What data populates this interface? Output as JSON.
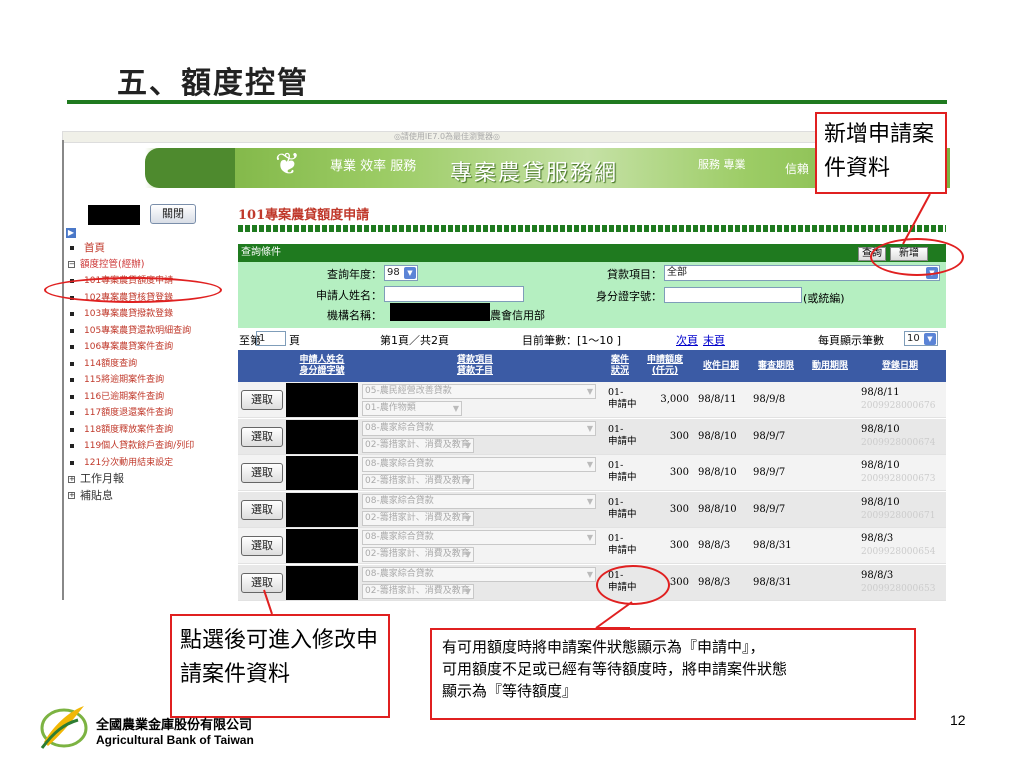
{
  "slide": {
    "title": "五、額度控管",
    "page_number": "12"
  },
  "browser": {
    "hint": "◎請使用IE7.0為最佳瀏覽器◎"
  },
  "banner": {
    "slogan_left": "專業 效率 服務",
    "title": "專案農貸服務網",
    "slogan_right1": "服務 專業",
    "slogan_right2": "信賴"
  },
  "sidebar": {
    "close_label": "關閉",
    "items": [
      {
        "label": "首頁",
        "level": "top"
      },
      {
        "label": "額度控管(經辦)",
        "level": "group"
      },
      {
        "label": "101專案農貸額度申請",
        "level": "sub"
      },
      {
        "label": "102專案農貸核貸登錄",
        "level": "sub"
      },
      {
        "label": "103專案農貸撥款登錄",
        "level": "sub"
      },
      {
        "label": "105專案農貸還款明細查詢",
        "level": "sub"
      },
      {
        "label": "106專案農貸案件查詢",
        "level": "sub"
      },
      {
        "label": "114額度查詢",
        "level": "sub"
      },
      {
        "label": "115將逾期案件查詢",
        "level": "sub"
      },
      {
        "label": "116已逾期案件查詢",
        "level": "sub"
      },
      {
        "label": "117額度退還案件查詢",
        "level": "sub"
      },
      {
        "label": "118額度釋放案件查詢",
        "level": "sub"
      },
      {
        "label": "119個人貸款餘戶查詢/列印",
        "level": "sub"
      },
      {
        "label": "121分次動用結束設定",
        "level": "sub"
      },
      {
        "label": "工作月報",
        "level": "folder"
      },
      {
        "label": "補貼息",
        "level": "folder"
      }
    ]
  },
  "main": {
    "page_title": "101專案農貸額度申請",
    "query": {
      "header": "查詢條件",
      "query_button": "查詢",
      "add_button": "新增",
      "year_label": "查詢年度：",
      "year_value": "98",
      "applicant_label": "申請人姓名：",
      "org_label": "機構名稱：",
      "org_value_suffix": "農會信用部",
      "loan_item_label": "貸款項目：",
      "loan_item_value": "全部",
      "id_label": "身分證字號：",
      "id_hint": "(或統編)"
    },
    "pager": {
      "to_page": "至第",
      "page_input": "1",
      "page_unit": "頁",
      "page_info": "第1頁／共2頁",
      "record_info": "目前筆數：[1～10 ]",
      "next": "次頁",
      "last": "末頁",
      "per_page_label": "每頁顯示筆數",
      "per_page_value": "10"
    },
    "columns": {
      "applicant": "申請人姓名",
      "id": "身分證字號",
      "loan_item": "貸款項目",
      "loan_subitem": "貸款子目",
      "status1": "案件",
      "status2": "狀況",
      "amount1": "申請額度",
      "amount2": "(仟元)",
      "received": "收件日期",
      "review": "審查期限",
      "use": "動用期限",
      "register": "登錄日期"
    },
    "rows": [
      {
        "pick": "選取",
        "item": "05-農民經營改善貸款",
        "sub": "01-農作物類",
        "status1": "01-",
        "status2": "申請中",
        "amount": "3,000",
        "received": "98/8/11",
        "review": "98/9/8",
        "use": "",
        "reg_date": "98/8/11",
        "reg_no": "2009928000676"
      },
      {
        "pick": "選取",
        "item": "08-農家綜合貸款",
        "sub": "02-籌措家計、消費及教育",
        "status1": "01-",
        "status2": "申請中",
        "amount": "300",
        "received": "98/8/10",
        "review": "98/9/7",
        "use": "",
        "reg_date": "98/8/10",
        "reg_no": "2009928000674"
      },
      {
        "pick": "選取",
        "item": "08-農家綜合貸款",
        "sub": "02-籌措家計、消費及教育",
        "status1": "01-",
        "status2": "申請中",
        "amount": "300",
        "received": "98/8/10",
        "review": "98/9/7",
        "use": "",
        "reg_date": "98/8/10",
        "reg_no": "2009928000673"
      },
      {
        "pick": "選取",
        "item": "08-農家綜合貸款",
        "sub": "02-籌措家計、消費及教育",
        "status1": "01-",
        "status2": "申請中",
        "amount": "300",
        "received": "98/8/10",
        "review": "98/9/7",
        "use": "",
        "reg_date": "98/8/10",
        "reg_no": "2009928000671"
      },
      {
        "pick": "選取",
        "item": "08-農家綜合貸款",
        "sub": "02-籌措家計、消費及教育",
        "status1": "01-",
        "status2": "申請中",
        "amount": "300",
        "received": "98/8/3",
        "review": "98/8/31",
        "use": "",
        "reg_date": "98/8/3",
        "reg_no": "2009928000654"
      },
      {
        "pick": "選取",
        "item": "08-農家綜合貸款",
        "sub": "02-籌措家計、消費及教育",
        "status1": "01-",
        "status2": "申請中",
        "amount": "300",
        "received": "98/8/3",
        "review": "98/8/31",
        "use": "",
        "reg_date": "98/8/3",
        "reg_no": "2009928000653"
      }
    ]
  },
  "callouts": {
    "add_note": "新增申請案件資料",
    "edit_note": "點選後可進入修改申請案件資料",
    "status_note_1": "有可用額度時將申請案件狀態顯示為『申請中』，",
    "status_note_2": "可用額度不足或已經有等待額度時，將申請案件狀態",
    "status_note_3": "顯示為『等待額度』"
  },
  "footer": {
    "company_zh": "全國農業金庫股份有限公司",
    "company_en": "Agricultural Bank of Taiwan"
  },
  "colors": {
    "accent_green": "#1f7a1f",
    "header_blue": "#3b5ba5",
    "callout_red": "#e02020",
    "query_bg": "#b5efc1"
  }
}
